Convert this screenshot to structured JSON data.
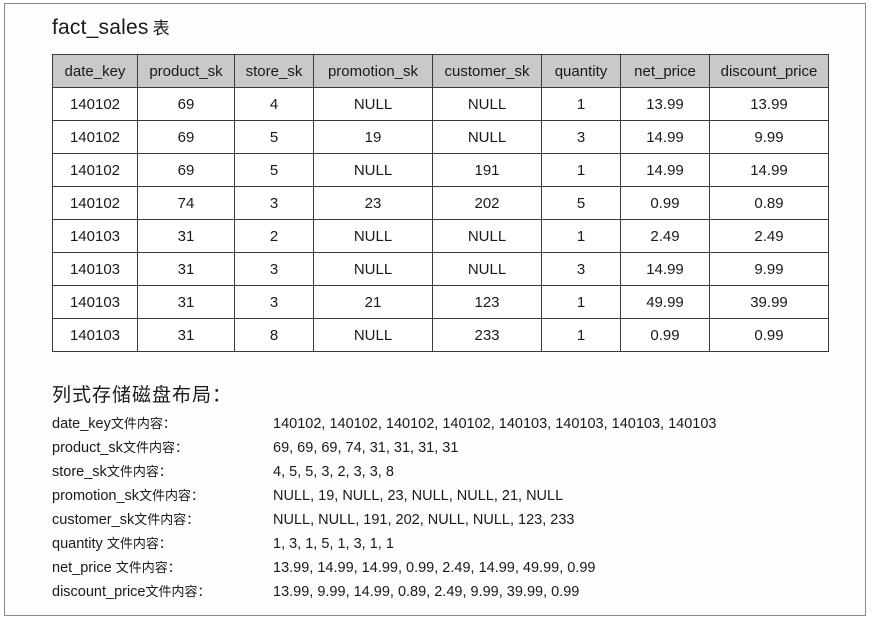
{
  "heading": {
    "name": "fact_sales",
    "suffix": "表"
  },
  "table": {
    "columns": [
      "date_key",
      "product_sk",
      "store_sk",
      "promotion_sk",
      "customer_sk",
      "quantity",
      "net_price",
      "discount_price"
    ],
    "rows": [
      [
        "140102",
        "69",
        "4",
        "NULL",
        "NULL",
        "1",
        "13.99",
        "13.99"
      ],
      [
        "140102",
        "69",
        "5",
        "19",
        "NULL",
        "3",
        "14.99",
        "9.99"
      ],
      [
        "140102",
        "69",
        "5",
        "NULL",
        "191",
        "1",
        "14.99",
        "14.99"
      ],
      [
        "140102",
        "74",
        "3",
        "23",
        "202",
        "5",
        "0.99",
        "0.89"
      ],
      [
        "140103",
        "31",
        "2",
        "NULL",
        "NULL",
        "1",
        "2.49",
        "2.49"
      ],
      [
        "140103",
        "31",
        "3",
        "NULL",
        "NULL",
        "3",
        "14.99",
        "9.99"
      ],
      [
        "140103",
        "31",
        "3",
        "21",
        "123",
        "1",
        "49.99",
        "39.99"
      ],
      [
        "140103",
        "31",
        "8",
        "NULL",
        "233",
        "1",
        "0.99",
        "0.99"
      ]
    ]
  },
  "columnar": {
    "title": "列式存储磁盘布局：",
    "file_suffix": "文件内容：",
    "items": [
      {
        "name": "date_key",
        "values": "140102, 140102, 140102, 140102, 140103, 140103, 140103, 140103"
      },
      {
        "name": "product_sk",
        "values": "69, 69, 69, 74, 31, 31, 31, 31"
      },
      {
        "name": "store_sk",
        "values": "4, 5, 5, 3, 2, 3, 3, 8"
      },
      {
        "name": "promotion_sk",
        "values": "NULL, 19, NULL, 23, NULL, NULL, 21, NULL"
      },
      {
        "name": "customer_sk",
        "values": "NULL, NULL, 191, 202, NULL, NULL, 123, 233"
      },
      {
        "name": "quantity",
        "values": "1, 3, 1, 5, 1, 3, 1, 1"
      },
      {
        "name": "net_price",
        "values": "13.99, 14.99, 14.99, 0.99, 2.49, 14.99, 49.99, 0.99"
      },
      {
        "name": "discount_price",
        "values": "13.99, 9.99, 14.99, 0.89, 2.49, 9.99, 39.99, 0.99"
      }
    ]
  }
}
